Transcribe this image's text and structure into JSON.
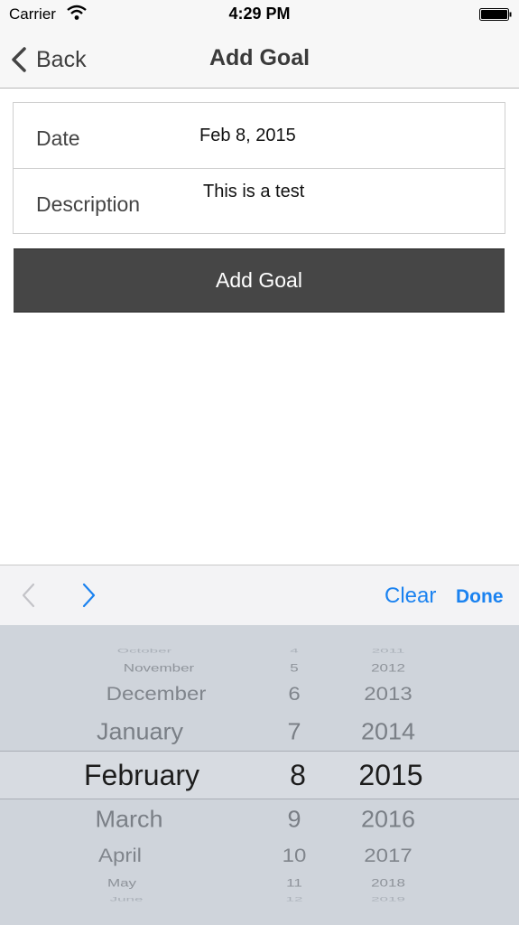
{
  "status_bar": {
    "carrier": "Carrier",
    "time": "4:29 PM"
  },
  "nav": {
    "back_label": "Back",
    "title": "Add Goal"
  },
  "form": {
    "date_label": "Date",
    "date_value": "Feb 8, 2015",
    "description_label": "Description",
    "description_value": "This is a test"
  },
  "add_button_label": "Add Goal",
  "toolbar": {
    "clear_label": "Clear",
    "done_label": "Done"
  },
  "picker": {
    "months": [
      "October",
      "November",
      "December",
      "January",
      "February",
      "March",
      "April",
      "May",
      "June"
    ],
    "days": [
      "4",
      "5",
      "6",
      "7",
      "8",
      "9",
      "10",
      "11",
      "12"
    ],
    "years": [
      "2011",
      "2012",
      "2013",
      "2014",
      "2015",
      "2016",
      "2017",
      "2018",
      "2019"
    ],
    "selected_index": 4
  }
}
